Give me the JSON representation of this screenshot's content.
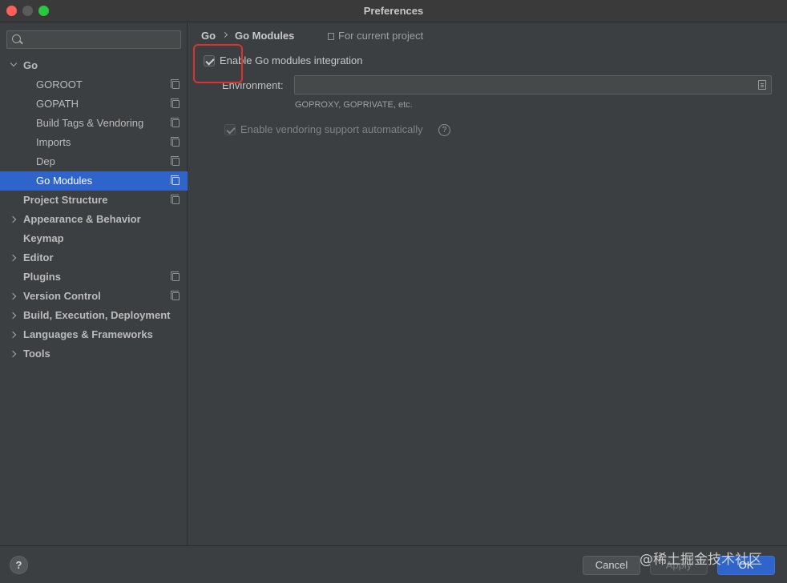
{
  "window": {
    "title": "Preferences"
  },
  "search": {
    "placeholder": ""
  },
  "sidebar": {
    "items": [
      {
        "label": "Go",
        "expandable": "expanded",
        "project_scoped": false,
        "selected": false
      },
      {
        "label": "GOROOT",
        "expandable": "none",
        "project_scoped": true,
        "selected": false
      },
      {
        "label": "GOPATH",
        "expandable": "none",
        "project_scoped": true,
        "selected": false
      },
      {
        "label": "Build Tags & Vendoring",
        "expandable": "none",
        "project_scoped": true,
        "selected": false
      },
      {
        "label": "Imports",
        "expandable": "none",
        "project_scoped": true,
        "selected": false
      },
      {
        "label": "Dep",
        "expandable": "none",
        "project_scoped": true,
        "selected": false
      },
      {
        "label": "Go Modules",
        "expandable": "none",
        "project_scoped": true,
        "selected": true
      },
      {
        "label": "Project Structure",
        "expandable": "none",
        "project_scoped": true,
        "selected": false
      },
      {
        "label": "Appearance & Behavior",
        "expandable": "collapsed",
        "project_scoped": false,
        "selected": false
      },
      {
        "label": "Keymap",
        "expandable": "none",
        "project_scoped": false,
        "selected": false
      },
      {
        "label": "Editor",
        "expandable": "collapsed",
        "project_scoped": false,
        "selected": false
      },
      {
        "label": "Plugins",
        "expandable": "none",
        "project_scoped": true,
        "selected": false
      },
      {
        "label": "Version Control",
        "expandable": "collapsed",
        "project_scoped": true,
        "selected": false
      },
      {
        "label": "Build, Execution, Deployment",
        "expandable": "collapsed",
        "project_scoped": false,
        "selected": false
      },
      {
        "label": "Languages & Frameworks",
        "expandable": "collapsed",
        "project_scoped": false,
        "selected": false
      },
      {
        "label": "Tools",
        "expandable": "collapsed",
        "project_scoped": false,
        "selected": false
      }
    ]
  },
  "main": {
    "breadcrumb": {
      "parent": "Go",
      "current": "Go Modules"
    },
    "scope_label": "For current project",
    "enable_modules": {
      "label": "Enable Go modules integration",
      "checked": true
    },
    "environment": {
      "label": "Environment:",
      "value": "",
      "hint": "GOPROXY, GOPRIVATE, etc."
    },
    "vendoring": {
      "label": "Enable vendoring support automatically",
      "checked": true,
      "enabled": false
    }
  },
  "footer": {
    "help_label": "?",
    "cancel_label": "Cancel",
    "apply_label": "Apply",
    "ok_label": "OK",
    "watermark": "@稀土掘金技术社区"
  },
  "colors": {
    "selection": "#2f65ca",
    "annotation_box": "#e03131",
    "background": "#3c3f41"
  }
}
